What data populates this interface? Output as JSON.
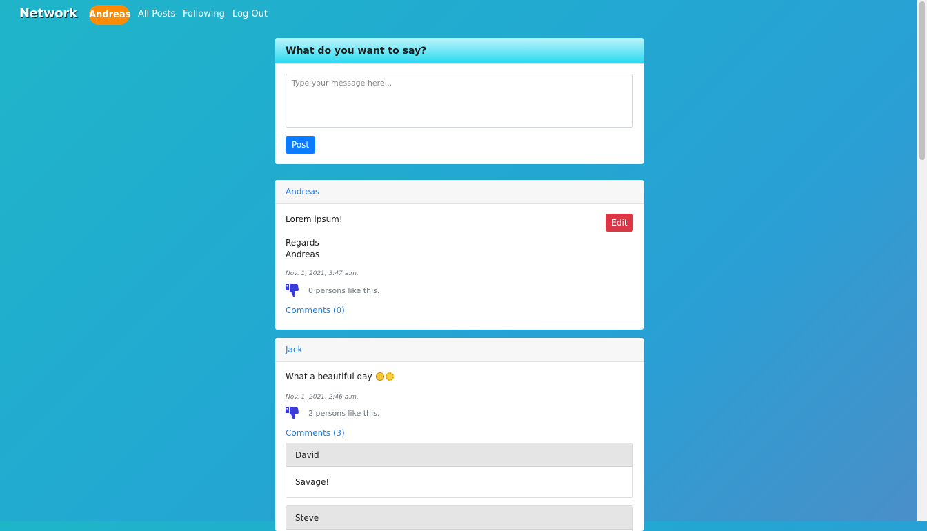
{
  "nav": {
    "brand": "Network",
    "active_user": "Andreas",
    "links": [
      "All Posts",
      "Following",
      "Log Out"
    ]
  },
  "compose": {
    "title": "What do you want to say?",
    "placeholder": "Type your message here...",
    "post_label": "Post"
  },
  "posts": [
    {
      "author": "Andreas",
      "lines": [
        "Lorem ipsum!",
        "",
        "Regards",
        "Andreas"
      ],
      "edit_label": "Edit",
      "timestamp": "Nov. 1, 2021, 3:47 a.m.",
      "likes_text": "0 persons like this.",
      "comments_label": "Comments (0)"
    },
    {
      "author": "Jack",
      "text": "What a beautiful day",
      "emojis": [
        "grinning-face-icon",
        "sun-icon"
      ],
      "timestamp": "Nov. 1, 2021, 2:46 a.m.",
      "likes_text": "2 persons like this.",
      "comments_label": "Comments (3)",
      "comments": [
        {
          "author": "David",
          "text": "Savage!"
        },
        {
          "author": "Steve",
          "text": ""
        }
      ]
    }
  ],
  "colors": {
    "accent": "#fd8b06",
    "primary": "#0d7bfd",
    "danger": "#dc3545",
    "thumb": "#3b3bd9"
  }
}
